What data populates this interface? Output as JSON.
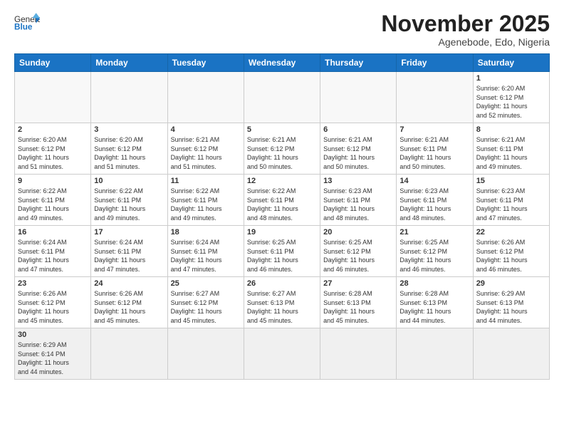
{
  "header": {
    "logo_general": "General",
    "logo_blue": "Blue",
    "month_title": "November 2025",
    "location": "Agenebode, Edo, Nigeria"
  },
  "weekdays": [
    "Sunday",
    "Monday",
    "Tuesday",
    "Wednesday",
    "Thursday",
    "Friday",
    "Saturday"
  ],
  "days": [
    {
      "date": "",
      "info": ""
    },
    {
      "date": "",
      "info": ""
    },
    {
      "date": "",
      "info": ""
    },
    {
      "date": "",
      "info": ""
    },
    {
      "date": "",
      "info": ""
    },
    {
      "date": "",
      "info": ""
    },
    {
      "date": "1",
      "info": "Sunrise: 6:20 AM\nSunset: 6:12 PM\nDaylight: 11 hours\nand 52 minutes."
    },
    {
      "date": "2",
      "info": "Sunrise: 6:20 AM\nSunset: 6:12 PM\nDaylight: 11 hours\nand 51 minutes."
    },
    {
      "date": "3",
      "info": "Sunrise: 6:20 AM\nSunset: 6:12 PM\nDaylight: 11 hours\nand 51 minutes."
    },
    {
      "date": "4",
      "info": "Sunrise: 6:21 AM\nSunset: 6:12 PM\nDaylight: 11 hours\nand 51 minutes."
    },
    {
      "date": "5",
      "info": "Sunrise: 6:21 AM\nSunset: 6:12 PM\nDaylight: 11 hours\nand 50 minutes."
    },
    {
      "date": "6",
      "info": "Sunrise: 6:21 AM\nSunset: 6:12 PM\nDaylight: 11 hours\nand 50 minutes."
    },
    {
      "date": "7",
      "info": "Sunrise: 6:21 AM\nSunset: 6:11 PM\nDaylight: 11 hours\nand 50 minutes."
    },
    {
      "date": "8",
      "info": "Sunrise: 6:21 AM\nSunset: 6:11 PM\nDaylight: 11 hours\nand 49 minutes."
    },
    {
      "date": "9",
      "info": "Sunrise: 6:22 AM\nSunset: 6:11 PM\nDaylight: 11 hours\nand 49 minutes."
    },
    {
      "date": "10",
      "info": "Sunrise: 6:22 AM\nSunset: 6:11 PM\nDaylight: 11 hours\nand 49 minutes."
    },
    {
      "date": "11",
      "info": "Sunrise: 6:22 AM\nSunset: 6:11 PM\nDaylight: 11 hours\nand 49 minutes."
    },
    {
      "date": "12",
      "info": "Sunrise: 6:22 AM\nSunset: 6:11 PM\nDaylight: 11 hours\nand 48 minutes."
    },
    {
      "date": "13",
      "info": "Sunrise: 6:23 AM\nSunset: 6:11 PM\nDaylight: 11 hours\nand 48 minutes."
    },
    {
      "date": "14",
      "info": "Sunrise: 6:23 AM\nSunset: 6:11 PM\nDaylight: 11 hours\nand 48 minutes."
    },
    {
      "date": "15",
      "info": "Sunrise: 6:23 AM\nSunset: 6:11 PM\nDaylight: 11 hours\nand 47 minutes."
    },
    {
      "date": "16",
      "info": "Sunrise: 6:24 AM\nSunset: 6:11 PM\nDaylight: 11 hours\nand 47 minutes."
    },
    {
      "date": "17",
      "info": "Sunrise: 6:24 AM\nSunset: 6:11 PM\nDaylight: 11 hours\nand 47 minutes."
    },
    {
      "date": "18",
      "info": "Sunrise: 6:24 AM\nSunset: 6:11 PM\nDaylight: 11 hours\nand 47 minutes."
    },
    {
      "date": "19",
      "info": "Sunrise: 6:25 AM\nSunset: 6:11 PM\nDaylight: 11 hours\nand 46 minutes."
    },
    {
      "date": "20",
      "info": "Sunrise: 6:25 AM\nSunset: 6:12 PM\nDaylight: 11 hours\nand 46 minutes."
    },
    {
      "date": "21",
      "info": "Sunrise: 6:25 AM\nSunset: 6:12 PM\nDaylight: 11 hours\nand 46 minutes."
    },
    {
      "date": "22",
      "info": "Sunrise: 6:26 AM\nSunset: 6:12 PM\nDaylight: 11 hours\nand 46 minutes."
    },
    {
      "date": "23",
      "info": "Sunrise: 6:26 AM\nSunset: 6:12 PM\nDaylight: 11 hours\nand 45 minutes."
    },
    {
      "date": "24",
      "info": "Sunrise: 6:26 AM\nSunset: 6:12 PM\nDaylight: 11 hours\nand 45 minutes."
    },
    {
      "date": "25",
      "info": "Sunrise: 6:27 AM\nSunset: 6:12 PM\nDaylight: 11 hours\nand 45 minutes."
    },
    {
      "date": "26",
      "info": "Sunrise: 6:27 AM\nSunset: 6:13 PM\nDaylight: 11 hours\nand 45 minutes."
    },
    {
      "date": "27",
      "info": "Sunrise: 6:28 AM\nSunset: 6:13 PM\nDaylight: 11 hours\nand 45 minutes."
    },
    {
      "date": "28",
      "info": "Sunrise: 6:28 AM\nSunset: 6:13 PM\nDaylight: 11 hours\nand 44 minutes."
    },
    {
      "date": "29",
      "info": "Sunrise: 6:29 AM\nSunset: 6:13 PM\nDaylight: 11 hours\nand 44 minutes."
    },
    {
      "date": "30",
      "info": "Sunrise: 6:29 AM\nSunset: 6:14 PM\nDaylight: 11 hours\nand 44 minutes."
    },
    {
      "date": "",
      "info": ""
    },
    {
      "date": "",
      "info": ""
    },
    {
      "date": "",
      "info": ""
    },
    {
      "date": "",
      "info": ""
    },
    {
      "date": "",
      "info": ""
    },
    {
      "date": "",
      "info": ""
    }
  ]
}
